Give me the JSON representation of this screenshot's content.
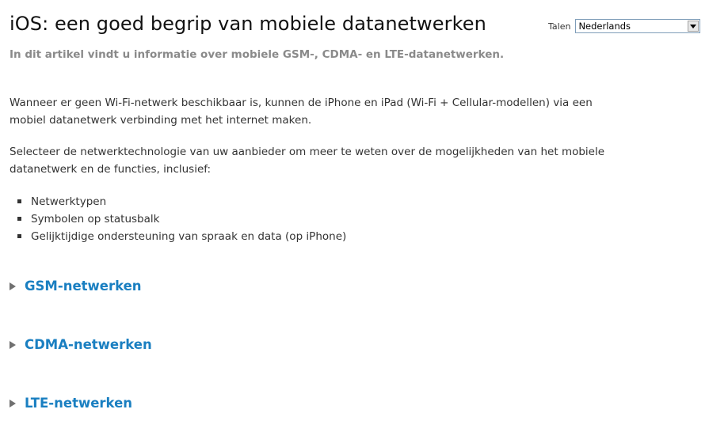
{
  "article": {
    "title": "iOS: een goed begrip van mobiele datanetwerken",
    "subtitle": "In dit artikel vindt u informatie over mobiele GSM-, CDMA- en LTE-datanetwerken."
  },
  "language": {
    "label": "Talen",
    "selected": "Nederlands"
  },
  "body": {
    "paragraph_1": "Wanneer er geen Wi-Fi-netwerk beschikbaar is, kunnen de iPhone en iPad (Wi-Fi + Cellular-modellen) via een mobiel datanetwerk verbinding met het internet maken.",
    "paragraph_2": "Selecteer de netwerktechnologie van uw aanbieder om meer te weten over de mogelijkheden van het mobiele datanetwerk en de functies, inclusief:",
    "bullets": [
      "Netwerktypen",
      "Symbolen op statusbalk",
      "Gelijktijdige ondersteuning van spraak en data (op iPhone)"
    ]
  },
  "sections": [
    {
      "label": "GSM-netwerken"
    },
    {
      "label": "CDMA-netwerken"
    },
    {
      "label": "LTE-netwerken"
    }
  ],
  "colors": {
    "link": "#1a7fc1",
    "subtitle": "#8a8a8a",
    "text": "#333333"
  },
  "icons": {
    "dropdown": "chevron-down-icon",
    "section_toggle": "triangle-right-icon",
    "bullet": "square-bullet-icon"
  }
}
